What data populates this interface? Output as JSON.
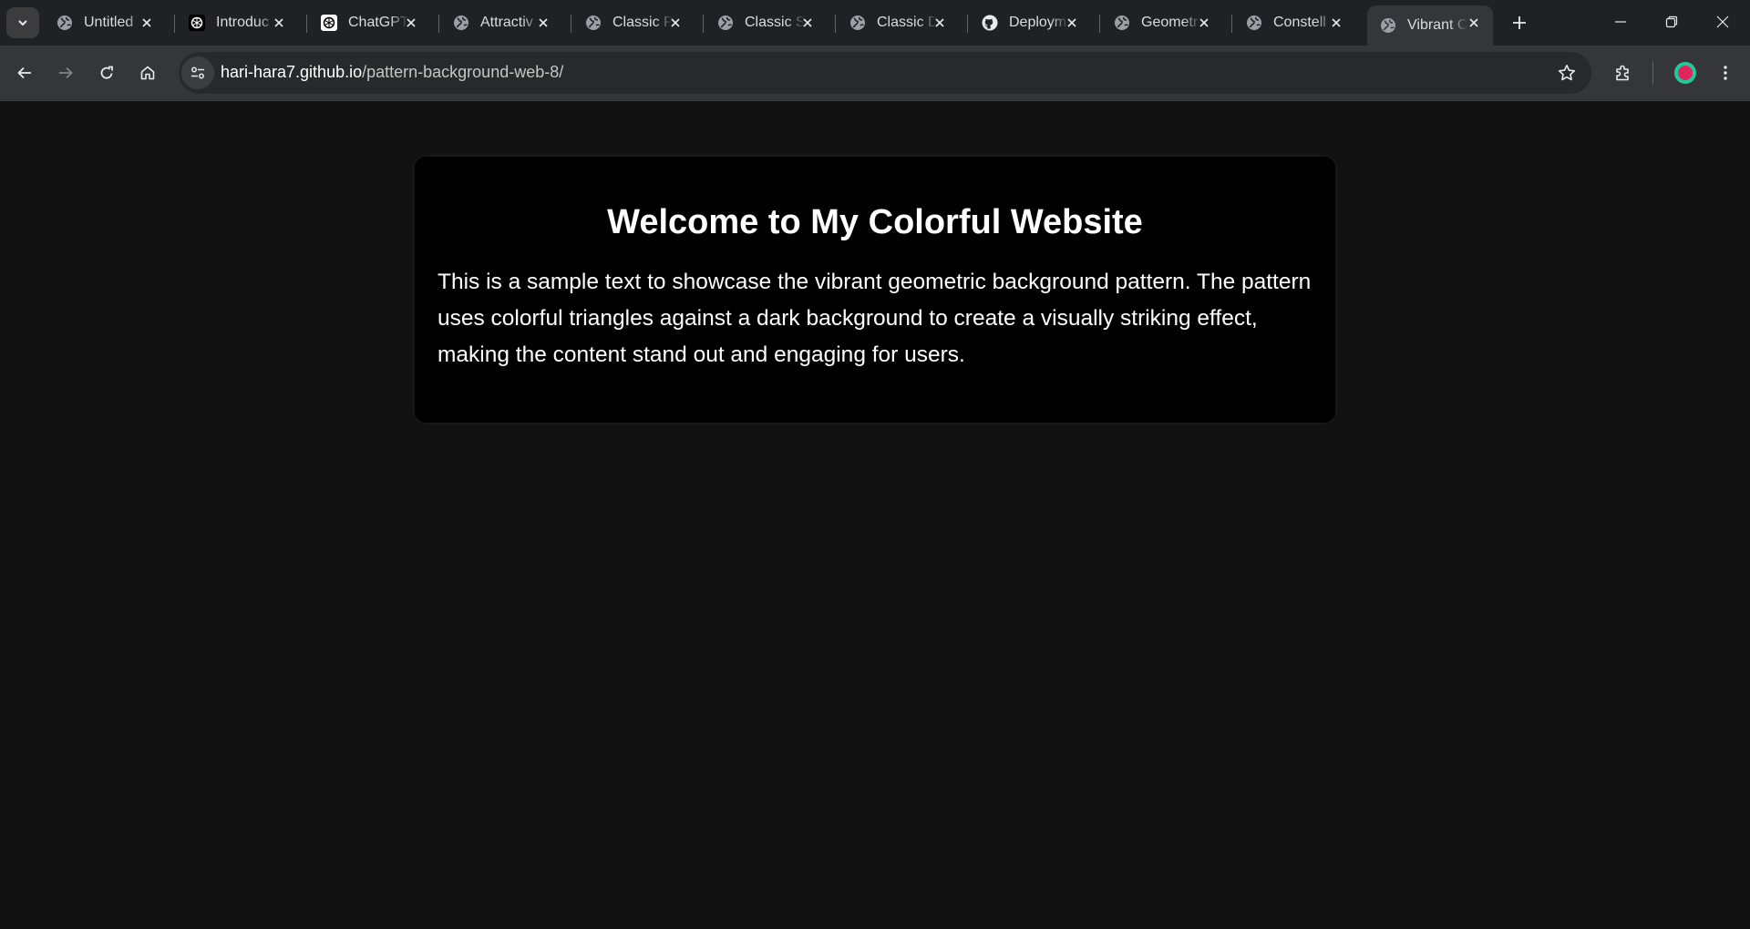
{
  "browser": {
    "tabs": [
      {
        "title": "Untitled",
        "icon": "globe-icon",
        "active": false
      },
      {
        "title": "Introduc",
        "icon": "openai-icon",
        "active": false
      },
      {
        "title": "ChatGPT",
        "icon": "openai-icon",
        "active": false
      },
      {
        "title": "Attractiv",
        "icon": "globe-icon",
        "active": false
      },
      {
        "title": "Classic P",
        "icon": "globe-icon",
        "active": false
      },
      {
        "title": "Classic S",
        "icon": "globe-icon",
        "active": false
      },
      {
        "title": "Classic D",
        "icon": "globe-icon",
        "active": false
      },
      {
        "title": "Deploym",
        "icon": "github-icon",
        "active": false
      },
      {
        "title": "Geometr",
        "icon": "globe-icon",
        "active": false
      },
      {
        "title": "Constell",
        "icon": "globe-icon",
        "active": false
      },
      {
        "title": "Vibrant C",
        "icon": "globe-icon",
        "active": true
      }
    ],
    "address": {
      "host": "hari-hara7.github.io",
      "path": "/pattern-background-web-8/"
    },
    "colors": {
      "tabstrip_bg": "#202124",
      "toolbar_bg": "#35363a",
      "omnibox_bg": "#28292c",
      "profile_ring": "#20c997",
      "profile_dot": "#e0245e"
    }
  },
  "page": {
    "heading": "Welcome to My Colorful Website",
    "body": "This is a sample text to showcase the vibrant geometric background pattern. The pattern uses colorful triangles against a dark background to create a visually striking effect, making the content stand out and engaging for users.",
    "colors": {
      "page_bg": "#111111",
      "card_bg": "#000000",
      "text": "#ffffff"
    }
  }
}
